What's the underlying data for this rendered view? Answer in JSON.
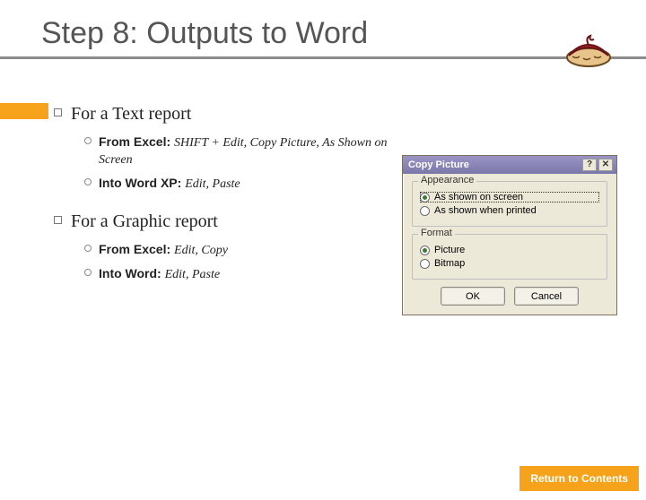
{
  "title": "Step 8: Outputs to Word",
  "bullets": [
    {
      "text": "For a Text report",
      "subs": [
        {
          "bold": "From Excel: ",
          "ital": "SHIFT + Edit, Copy Picture, As Shown on Screen"
        },
        {
          "bold": "Into Word XP: ",
          "ital": "Edit, Paste"
        }
      ]
    },
    {
      "text": "For a Graphic report",
      "subs": [
        {
          "bold": "From Excel: ",
          "ital": "Edit, Copy"
        },
        {
          "bold": "Into Word: ",
          "ital": "Edit, Paste"
        }
      ]
    }
  ],
  "dialog": {
    "title": "Copy Picture",
    "help_glyph": "?",
    "close_glyph": "✕",
    "appearance": {
      "legend": "Appearance",
      "opt1": "As shown on screen",
      "opt2": "As shown when printed"
    },
    "format": {
      "legend": "Format",
      "opt1": "Picture",
      "opt2": "Bitmap"
    },
    "ok": "OK",
    "cancel": "Cancel"
  },
  "return_label": "Return to Contents"
}
